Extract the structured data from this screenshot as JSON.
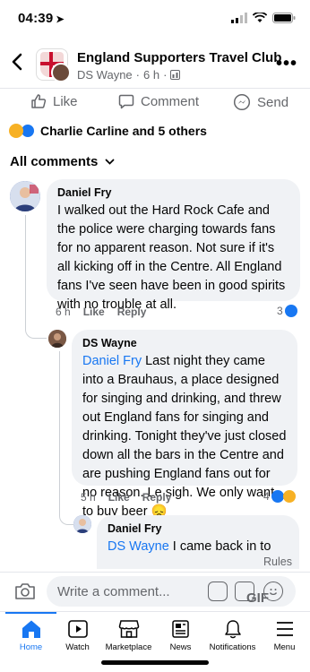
{
  "status": {
    "time": "04:39"
  },
  "header": {
    "title": "England Supporters Travel Club",
    "author": "DS Wayne",
    "age": "6 h"
  },
  "actions": {
    "like": "Like",
    "comment": "Comment",
    "send": "Send"
  },
  "reactions": {
    "summary": "Charlie Carline and 5 others"
  },
  "comments_filter": "All comments",
  "comments": [
    {
      "author": "Daniel Fry",
      "text": "I walked out the Hard Rock Cafe and the police were charging towards fans for no apparent reason. Not sure if it's all kicking off in the Centre. All England fans I've seen have been in good spirits with no trouble at all.",
      "age": "6 h",
      "like": "Like",
      "reply": "Reply",
      "reaction_count": "3"
    },
    {
      "author": "DS Wayne",
      "mention": "Daniel Fry",
      "text": " Last night they came into a Brauhaus, a place designed for singing and drinking, and threw out England fans for singing and drinking. Tonight they've just closed down all the bars in the Centre and are pushing England fans out for no reason. Le sigh. We only want to buy beer 😞",
      "age": "5 h",
      "like": "Like",
      "reply": "Reply",
      "reaction_count": "4"
    },
    {
      "author": "Daniel Fry",
      "mention": "DS Wayne",
      "text": " I came back in to"
    }
  ],
  "rules": "Rules",
  "composer": {
    "placeholder": "Write a comment...",
    "gif": "GIF"
  },
  "tabs": [
    {
      "label": "Home"
    },
    {
      "label": "Watch"
    },
    {
      "label": "Marketplace"
    },
    {
      "label": "News"
    },
    {
      "label": "Notifications"
    },
    {
      "label": "Menu"
    }
  ],
  "colors": {
    "accent": "#1877f2",
    "bubble": "#f0f2f5",
    "muted": "#65676b"
  }
}
